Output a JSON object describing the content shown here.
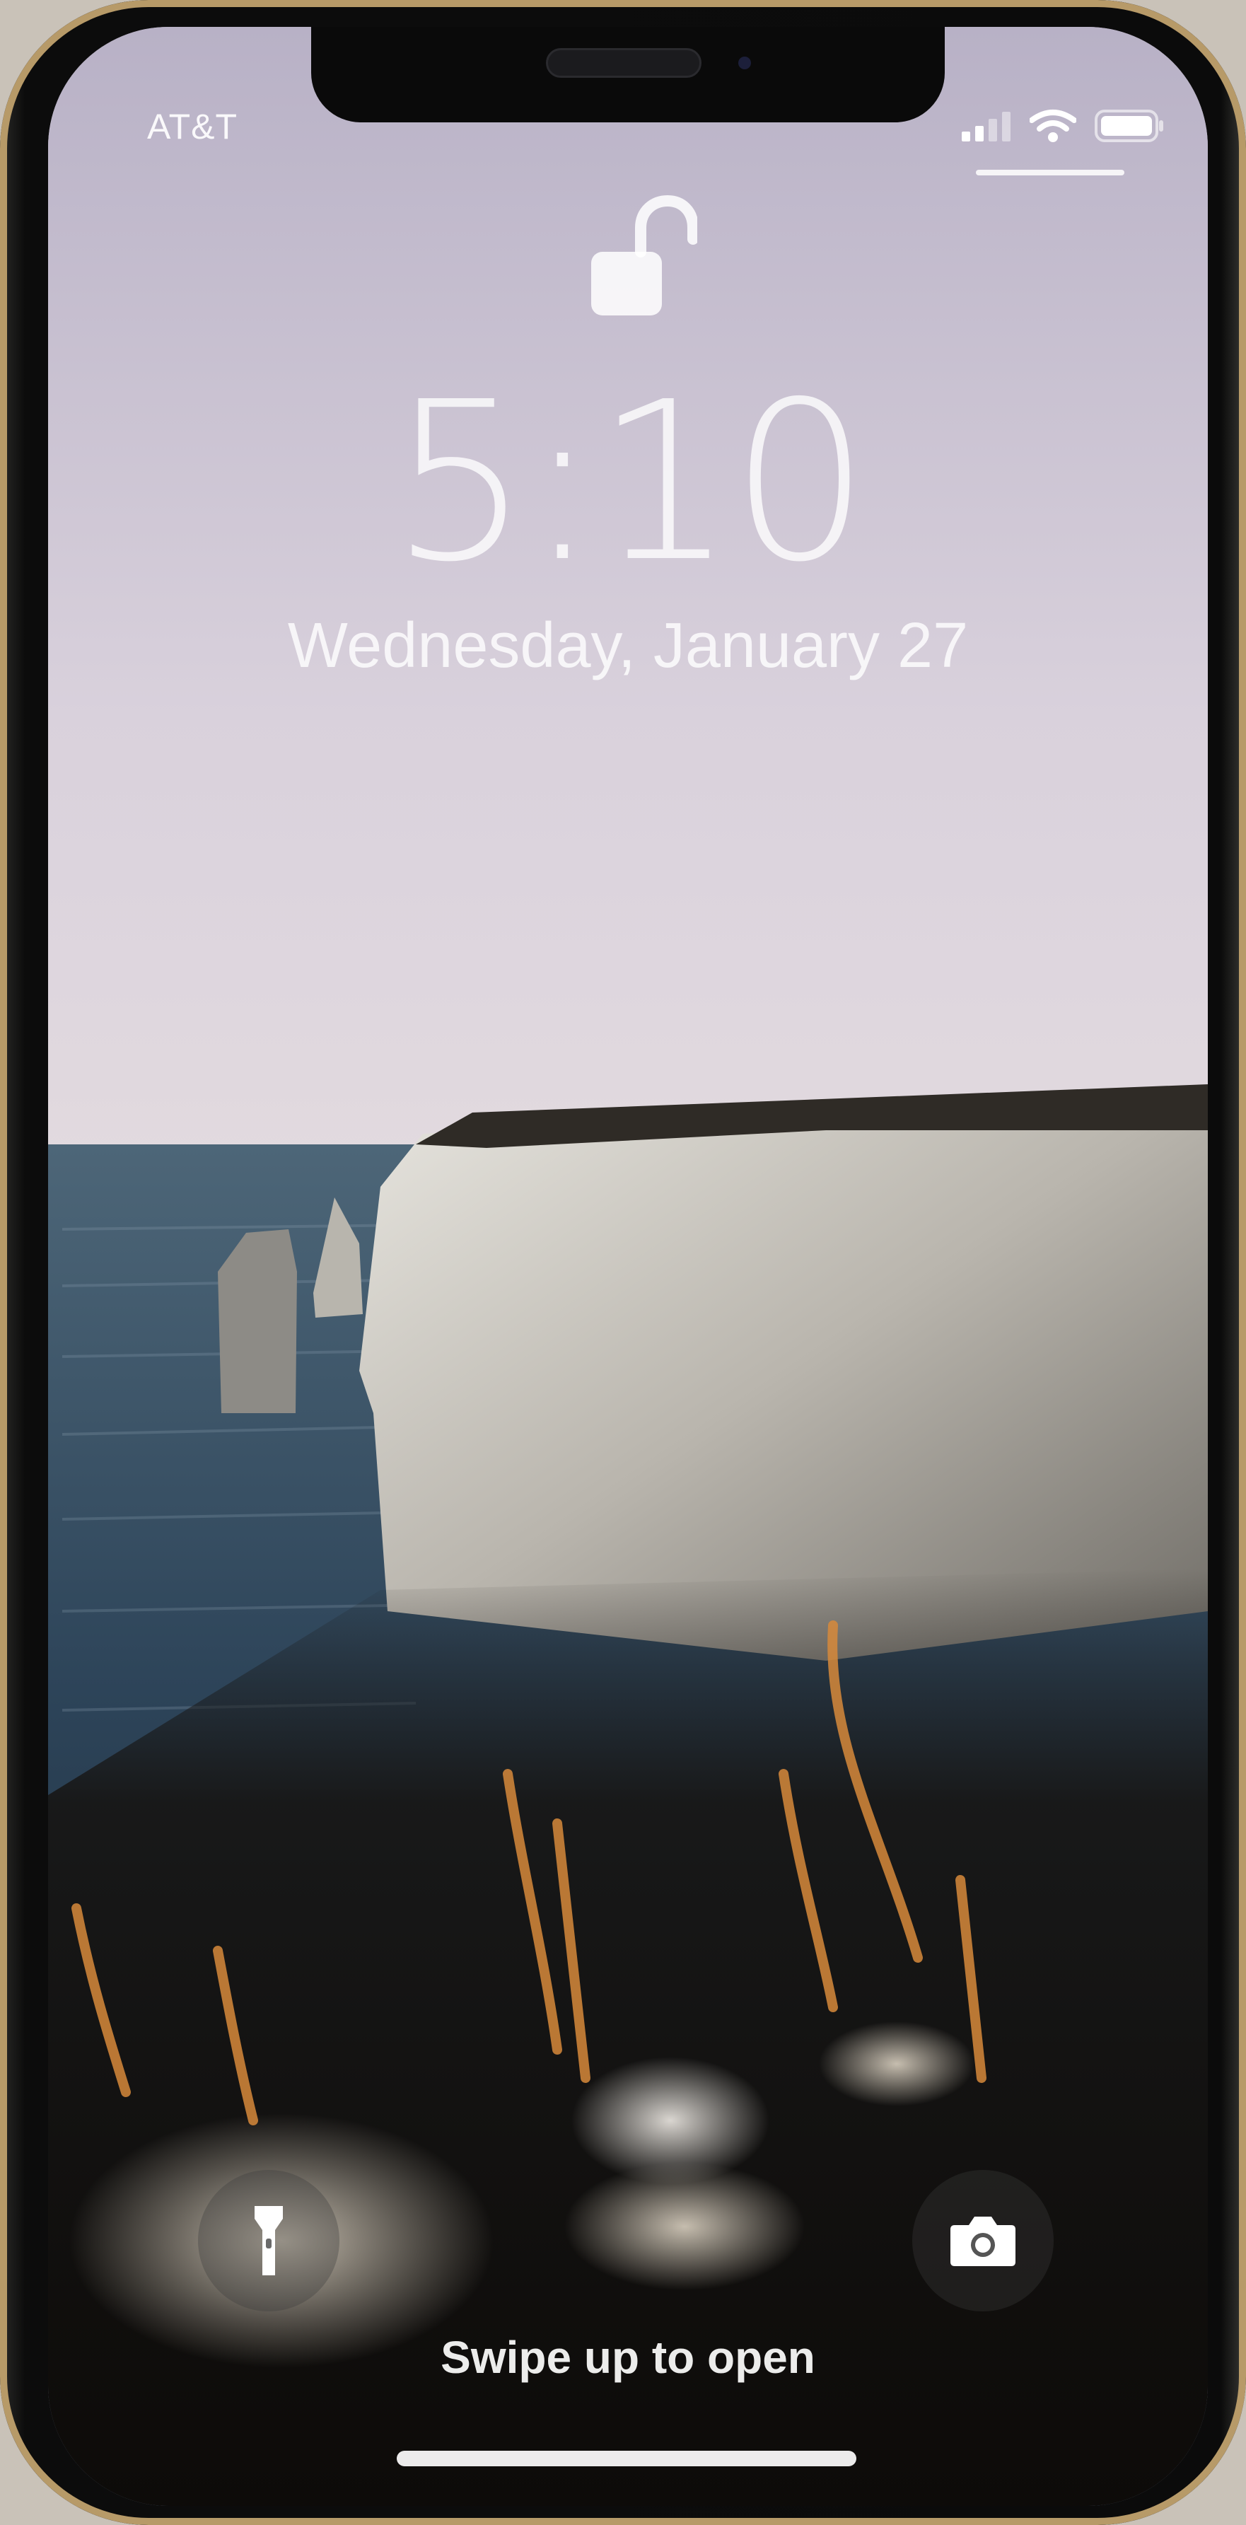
{
  "status_bar": {
    "carrier": "AT&T",
    "icons": [
      "cellular-signal-icon",
      "wifi-icon",
      "battery-icon"
    ]
  },
  "lock_screen": {
    "lock_state_icon": "unlocked-padlock-icon",
    "time": "5:10",
    "date": "Wednesday, January 27",
    "swipe_hint": "Swipe up to open"
  },
  "quick_actions": {
    "left": "flashlight-icon",
    "right": "camera-icon"
  },
  "colors": {
    "sky_top": "#b9b2c6",
    "sky_bottom": "#ddd5df",
    "sea": "#23364a",
    "cliff": "#c9c6bf",
    "frame_gold": "#b79a68"
  }
}
